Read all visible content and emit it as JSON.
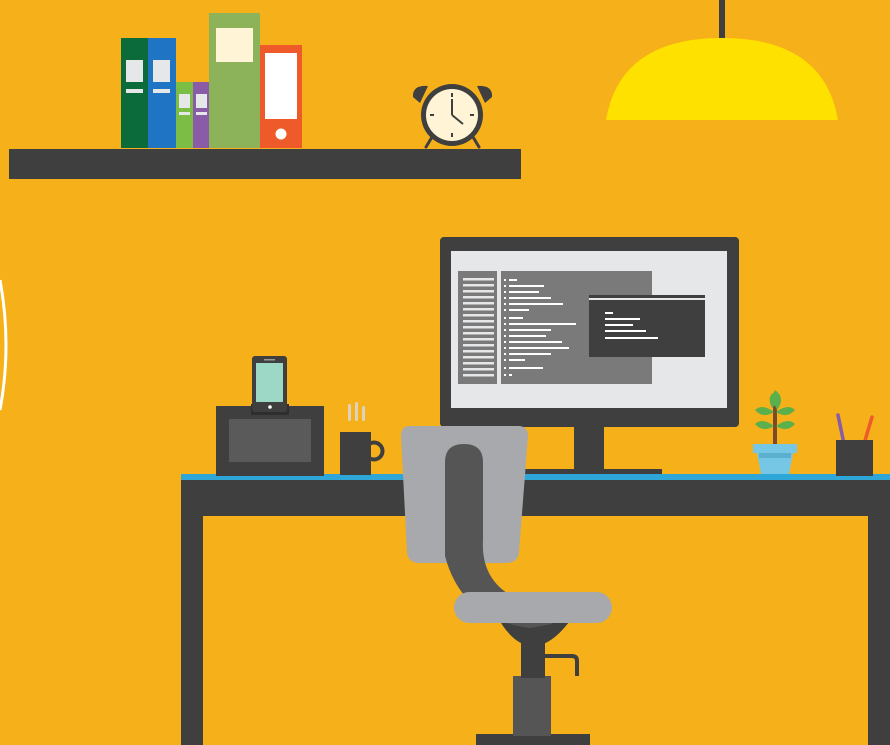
{
  "scene": {
    "type": "flat-illustration-workspace",
    "palette": {
      "background": "#F5B01A",
      "dark_gray": "#3F3F3F",
      "desk_top_accent": "#2FA6D8",
      "lamp_yellow": "#FFE100",
      "chair_gray": "#A7A9AC",
      "book_dark_green": "#0B6B3A",
      "book_blue": "#1F74C4",
      "book_light_green": "#7CBE45",
      "book_purple": "#8A5BA6",
      "book_sage": "#8DB35A",
      "book_orange": "#EF5A2B",
      "screen_light": "#E6E7E8",
      "plant_green": "#5BB04B",
      "pot_blue": "#76C6E5"
    },
    "icons": [
      "bookshelf-icon",
      "binder-icon",
      "alarm-clock-icon",
      "pendant-lamp-icon",
      "desk-icon",
      "monitor-icon",
      "code-window-icon",
      "terminal-window-icon",
      "phone-dock-icon",
      "smartphone-icon",
      "coffee-mug-icon",
      "potted-plant-icon",
      "pencil-cup-icon",
      "office-chair-icon"
    ]
  }
}
